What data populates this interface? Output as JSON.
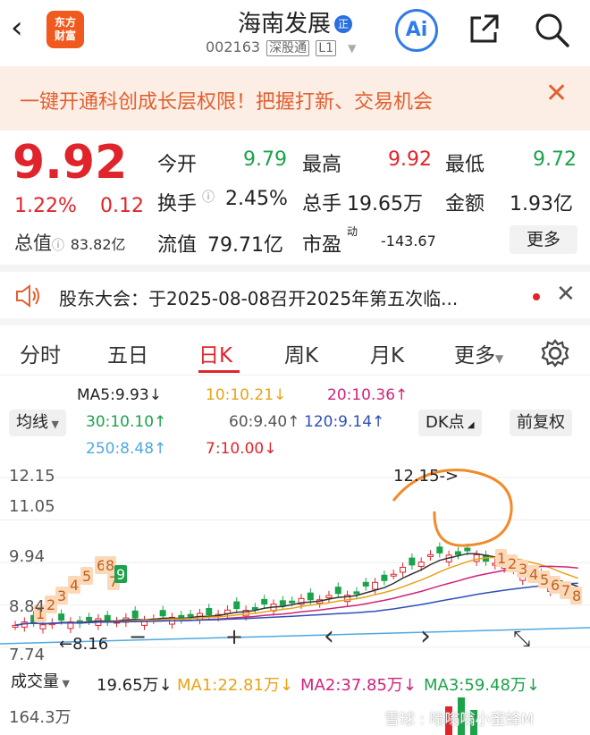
{
  "header": {
    "logo_line1": "东方",
    "logo_line2": "财富",
    "title": "海南发展",
    "title_badge": "正",
    "code": "002163",
    "market": "深股通",
    "level": "L1",
    "ai_label": "Ai"
  },
  "banner": {
    "text": "一键开通科创成长层权限！把握打新、交易机会"
  },
  "quote": {
    "price": "9.92",
    "change_pct": "1.22%",
    "change": "0.12",
    "total_value_label": "总值",
    "total_value": "83.82亿",
    "open_label": "今开",
    "open": "9.79",
    "high_label": "最高",
    "high": "9.92",
    "low_label": "最低",
    "low": "9.72",
    "turnover_label": "换手",
    "turnover": "2.45%",
    "volume_label": "总手",
    "volume": "19.65万",
    "amount_label": "金额",
    "amount": "1.93亿",
    "float_label": "流值",
    "float_value": "79.71亿",
    "pe_label": "市盈",
    "pe_sup": "动",
    "pe": "-143.67",
    "more_label": "更多"
  },
  "notice": {
    "text": "股东大会：于2025-08-08召开2025年第五次临..."
  },
  "tabs": [
    "分时",
    "五日",
    "日K",
    "周K",
    "月K",
    "更多"
  ],
  "active_tab": "日K",
  "indicators": {
    "avg_label": "均线",
    "ma5": "MA5:9.93↓",
    "ma10": "10:10.21↓",
    "ma20": "20:10.36↑",
    "ma30": "30:10.10↑",
    "ma60": "60:9.40↑",
    "ma120": "120:9.14↑",
    "ma250": "250:8.48↑",
    "ma7": "7:10.00↓",
    "dk_label": "DK点",
    "fq_label": "前复权"
  },
  "chart_data": {
    "type": "candlestick",
    "y_ticks": [
      "12.15",
      "11.05",
      "9.94",
      "8.84",
      "7.74"
    ],
    "peak_annotation": "12.15->",
    "low_annotation": "8.16",
    "marker_labels": [
      "1",
      "2",
      "3",
      "4",
      "5",
      "6",
      "7",
      "8",
      "9"
    ],
    "marker_labels_right": [
      "1",
      "2",
      "3",
      "4",
      "5",
      "6",
      "7",
      "8"
    ],
    "annotation_digit": "6",
    "ylim": [
      7.74,
      12.15
    ],
    "colors": {
      "up": "#e0242b",
      "down": "#1aa34a",
      "ma5": "#333333",
      "ma10": "#e8a317",
      "ma20": "#d0237a",
      "ma60": "#888888",
      "ma120": "#2f4fb8",
      "ma250": "#4fa8e0",
      "annotation": "#f08a2a"
    }
  },
  "chart_controls": {
    "minus": "−",
    "plus": "+",
    "prev": "‹",
    "next": "›",
    "expand": "⤡"
  },
  "volume": {
    "label": "成交量",
    "value": "19.65万↓",
    "ma1": "MA1:22.81万↓",
    "ma2": "MA2:37.85万↓",
    "ma3": "MA3:59.48万↓",
    "axis_top": "164.3万"
  },
  "watermark": "雪球 : 嗡嗡嗡小蜜蜂M"
}
